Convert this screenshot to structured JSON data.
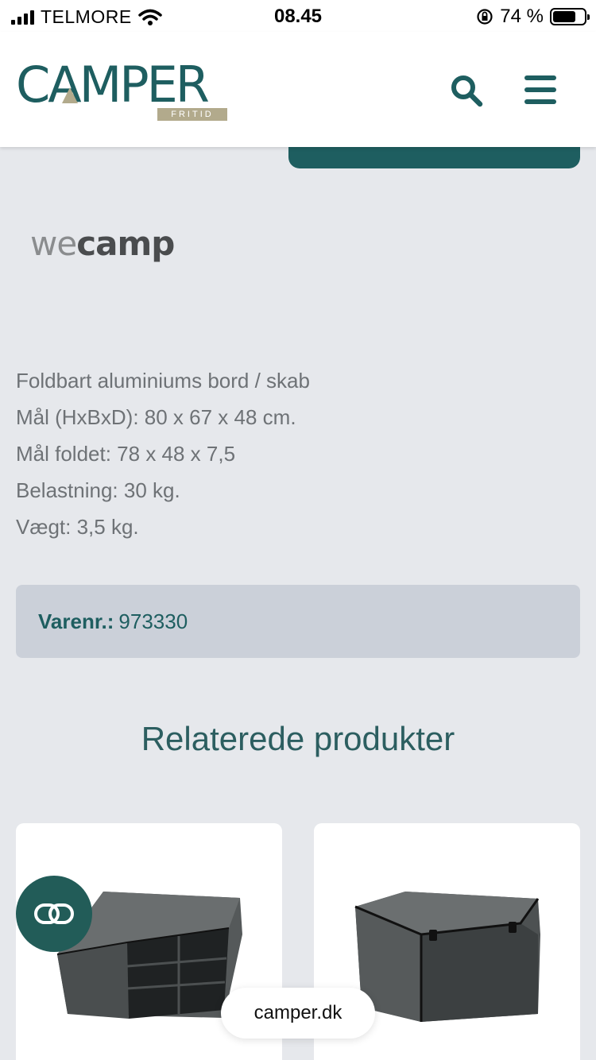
{
  "status_bar": {
    "carrier": "TELMORE",
    "time": "08.45",
    "battery_text": "74 %",
    "battery_level": 0.74
  },
  "header": {
    "logo_text": "CAMPER",
    "logo_subtext": "FRITID",
    "brand_color": "#1e5e60",
    "icons": [
      "search-icon",
      "hamburger-menu-icon"
    ]
  },
  "product": {
    "brand_we": "we",
    "brand_camp": "camp",
    "description": [
      "Foldbart aluminiums bord / skab",
      "Mål (HxBxD): 80 x 67 x 48 cm.",
      "Mål foldet: 78 x 48 x 7,5",
      "Belastning: 30 kg.",
      "Vægt: 3,5 kg."
    ],
    "sku_label": "Varenr.:",
    "sku_value": "973330"
  },
  "related": {
    "title": "Relaterede produkter"
  },
  "browser": {
    "url": "camper.dk"
  }
}
